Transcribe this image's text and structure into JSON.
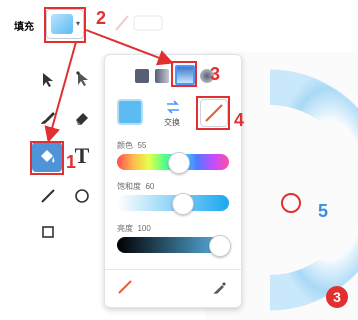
{
  "toolbar": {
    "fill_label": "填充",
    "fill_color": "#5cbcf2",
    "caret": "▾"
  },
  "tools": [
    {
      "name": "select-arrow-icon"
    },
    {
      "name": "reshape-arrow-icon"
    },
    {
      "name": "brush-icon"
    },
    {
      "name": "eraser-icon"
    },
    {
      "name": "fill-bucket-icon"
    },
    {
      "name": "text-tool-icon",
      "glyph": "T"
    },
    {
      "name": "line-tool-icon"
    },
    {
      "name": "circle-tool-icon"
    },
    {
      "name": "rectangle-tool-icon"
    }
  ],
  "popover": {
    "swap_label": "交换",
    "color_label": "颜色",
    "color_value": "55",
    "saturation_label": "饱和度",
    "saturation_value": "60",
    "brightness_label": "亮度",
    "brightness_value": "100",
    "sliders": {
      "color": 0.55,
      "saturation": 0.6,
      "brightness": 1.0
    }
  },
  "annotations": {
    "n1": "1",
    "n2": "2",
    "n3": "3",
    "n4": "4",
    "n5": "5",
    "step_badge": "3"
  },
  "colors": {
    "accent": "#e03030",
    "fill_blue": "#5cbcf2",
    "ring_blue": "#a9d9f6"
  }
}
